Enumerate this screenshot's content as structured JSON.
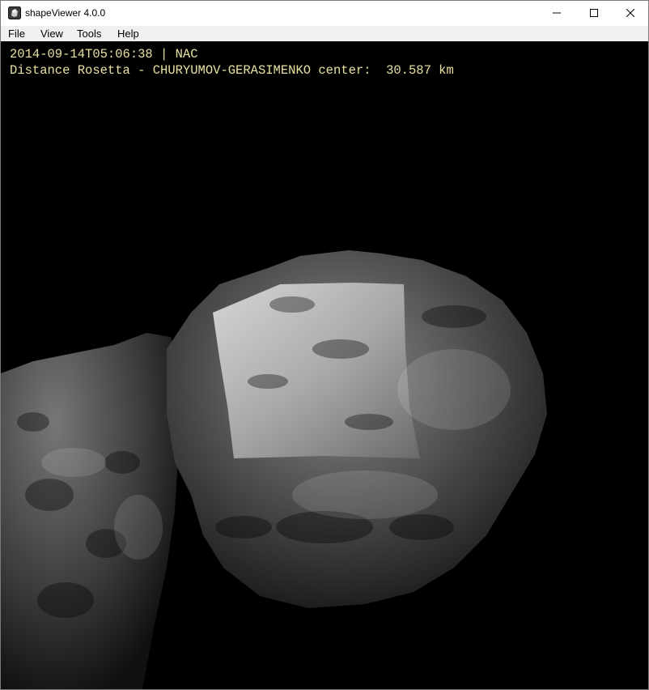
{
  "window": {
    "title": "shapeViewer 4.0.0",
    "controls": [
      "minimize-icon",
      "maximize-icon",
      "close-icon"
    ]
  },
  "menu": {
    "items": [
      "File",
      "View",
      "Tools",
      "Help"
    ]
  },
  "viewport": {
    "overlay": {
      "line1": "2014-09-14T05:06:38 | NAC",
      "line2": "Distance Rosetta - CHURYUMOV-GERASIMENKO center:  30.587 km"
    },
    "text_color": "#e8e0a0",
    "background": "#000000"
  }
}
